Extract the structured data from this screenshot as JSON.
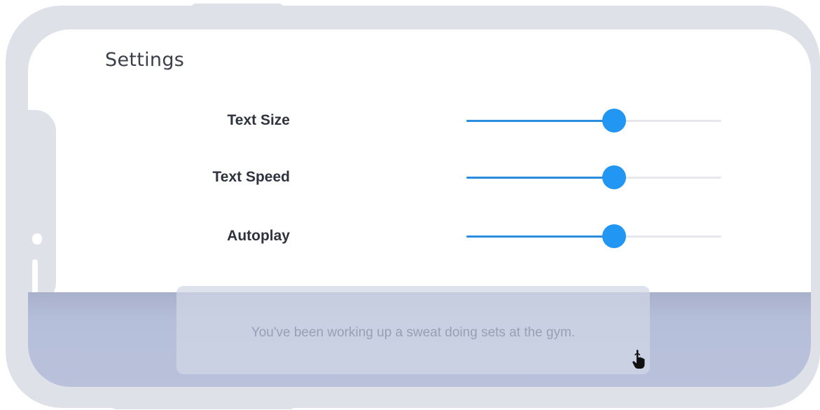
{
  "settings": {
    "title": "Settings",
    "rows": [
      {
        "label": "Text Size",
        "value": 0.58
      },
      {
        "label": "Text Speed",
        "value": 0.58
      },
      {
        "label": "Autoplay",
        "value": 0.58
      }
    ]
  },
  "dialog": {
    "text": "You've been working up a sweat doing sets at the gym.",
    "tap_icon": "pointing-hand-icon"
  },
  "colors": {
    "frame": "#dee1e7",
    "slider_fill": "#2a8cdf",
    "slider_thumb": "#2196f3",
    "slider_track": "#e6e8ee",
    "panel": "#b9c1db"
  }
}
